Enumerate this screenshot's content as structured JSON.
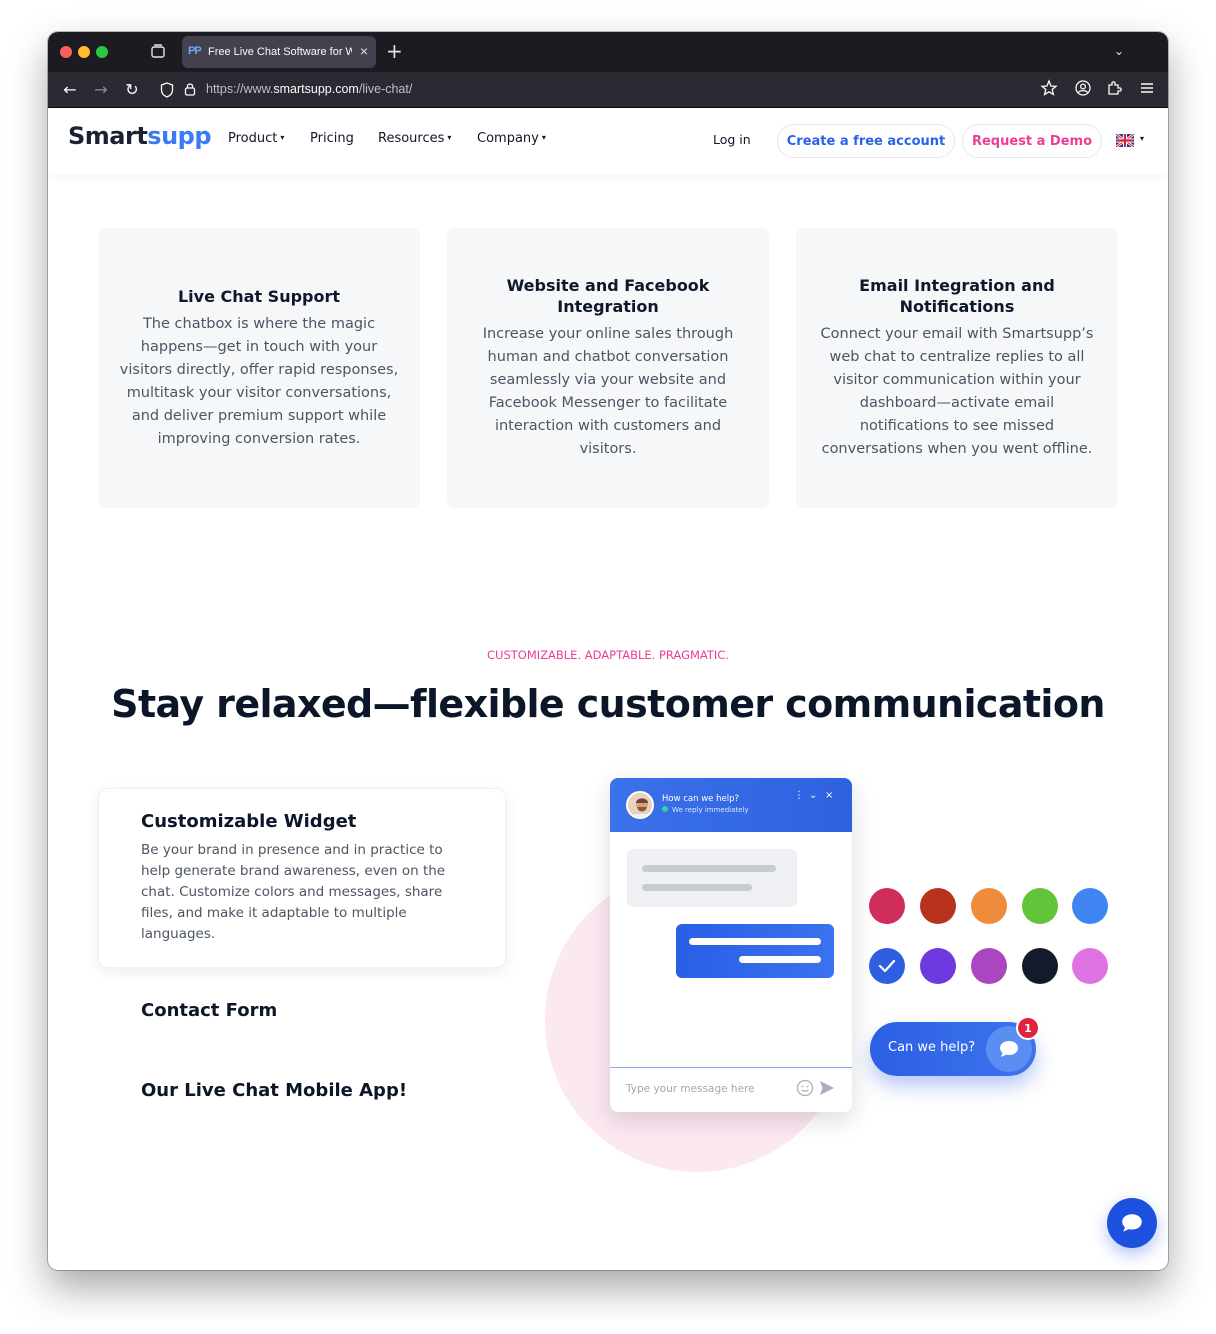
{
  "browser": {
    "tab_title": "Free Live Chat Software for Web",
    "tab_favicon_text": "PP",
    "new_tab_symbol": "+",
    "url_prefix": "https://www.",
    "url_host": "smartsupp.com",
    "url_path": "/live-chat/"
  },
  "header": {
    "logo_part1": "Smart",
    "logo_part2": "supp",
    "nav": [
      {
        "label": "Product",
        "has_caret": true
      },
      {
        "label": "Pricing",
        "has_caret": false
      },
      {
        "label": "Resources",
        "has_caret": true
      },
      {
        "label": "Company",
        "has_caret": true
      }
    ],
    "login": "Log in",
    "create_account": "Create a free account",
    "request_demo": "Request a Demo",
    "language_icon": "uk-flag-icon"
  },
  "cards": [
    {
      "title": "Live Chat Support",
      "text": "The chatbox is where the magic happens—get in touch with your visitors directly, offer rapid responses, multitask your visitor conversations, and deliver premium support while improving conversion rates."
    },
    {
      "title": "Website and Facebook Integration",
      "text": "Increase your online sales through human and chatbot conversation seamlessly via your website and Facebook Messenger to facilitate interaction with customers and visitors."
    },
    {
      "title": "Email Integration and Notifications",
      "text": "Connect your email with Smartsupp’s web chat to centralize replies to all visitor communication within your dashboard—activate email notifications to see missed conversations when you went offline."
    }
  ],
  "section": {
    "eyebrow": "CUSTOMIZABLE. ADAPTABLE. PRAGMATIC.",
    "headline": "Stay relaxed—flexible customer communication"
  },
  "features": {
    "active": {
      "title": "Customizable Widget",
      "text": "Be your brand in presence and in practice to help generate brand awareness, even on the chat. Customize colors and messages, share files, and make it adaptable to multiple languages."
    },
    "items": [
      "Contact Form",
      "Our Live Chat Mobile App!"
    ]
  },
  "widget": {
    "title": "How can we help?",
    "subtitle": "We reply immediately",
    "placeholder": "Type your message here",
    "cta_label": "Can we help?",
    "badge_count": "1"
  },
  "colors": {
    "accent_blue": "#2b63e8",
    "accent_pink": "#ec3d96",
    "swatches_row1": [
      "#cf2e5a",
      "#b8321c",
      "#ef8c3c",
      "#5fc43a",
      "#3f84f0"
    ],
    "swatches_row2": [
      "#2d5fe0",
      "#6d3ae0",
      "#ab45c0",
      "#141a2b",
      "#dd73e0"
    ],
    "selected_swatch": "#2d5fe0"
  }
}
